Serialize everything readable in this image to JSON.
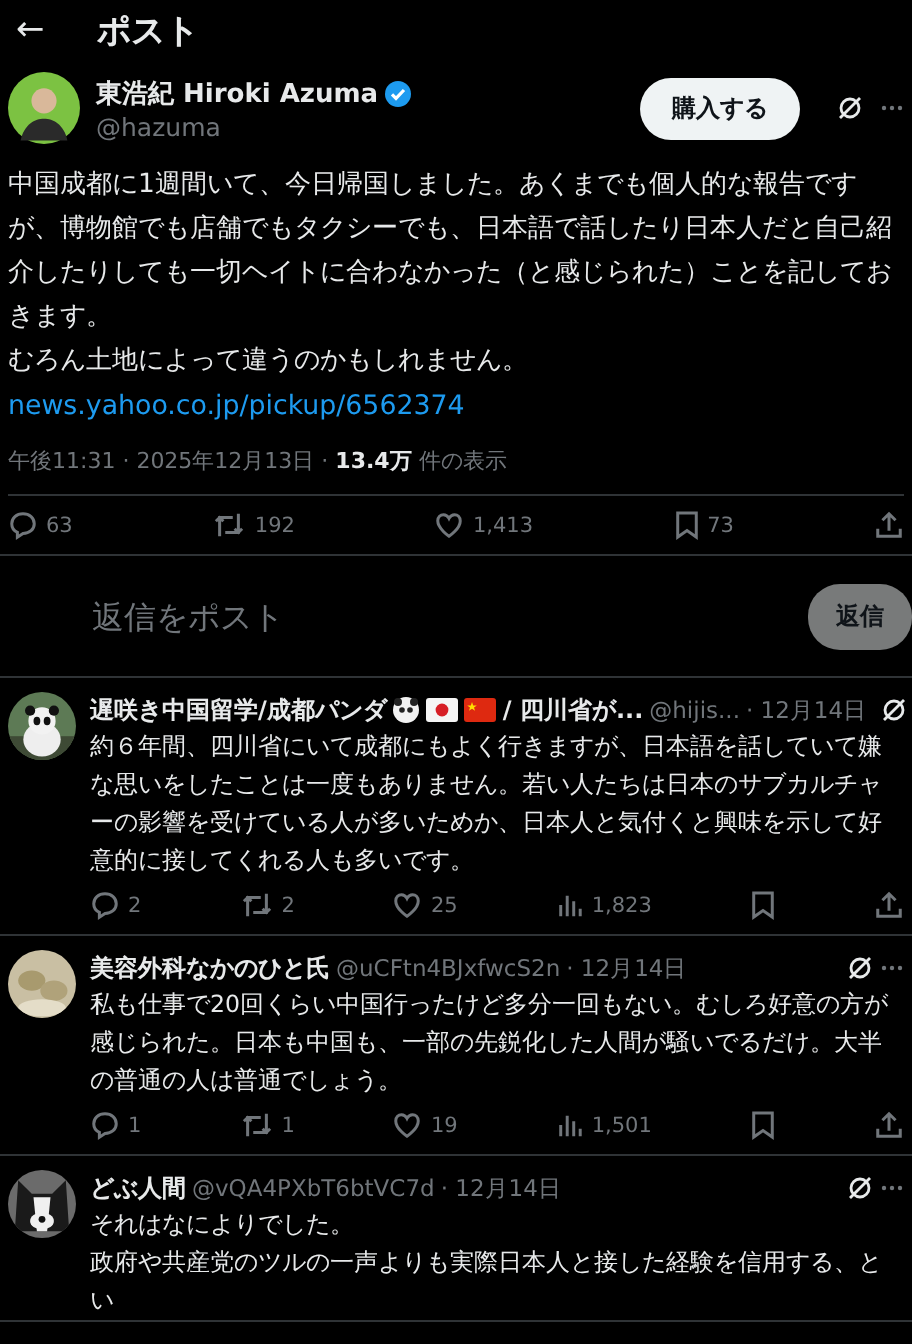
{
  "header": {
    "back": "←",
    "title": "ポスト"
  },
  "post": {
    "author": "東浩紀 Hiroki Azuma",
    "verified": true,
    "handle": "@hazuma",
    "buy_button": "購入する",
    "paragraphs": [
      "中国成都に1週間いて、今日帰国しました。あくまでも個人的な報告ですが、博物館でも店舗でもタクシーでも、日本語で話したり日本人だと自己紹介したりしても一切ヘイトに合わなかった（と感じられた）ことを記しておきます。",
      "むろん土地によって違うのかもしれません。"
    ],
    "link": "news.yahoo.co.jp/pickup/6562374",
    "meta": "午後11:31 · 2025年12月13日 · ",
    "views": "13.4万",
    "views_suffix": " 件の表示",
    "actions": [
      {
        "kind": "reply",
        "count": "63"
      },
      {
        "kind": "repost",
        "count": "192"
      },
      {
        "kind": "like",
        "count": "1,413"
      },
      {
        "kind": "bookmark",
        "count": "73"
      },
      {
        "kind": "share"
      }
    ]
  },
  "reply_box": {
    "placeholder": "返信をポスト",
    "button": "返信"
  },
  "replies": [
    {
      "name": [
        {
          "kind": "text",
          "text": "遅咲き中国留学/成都パンダ"
        },
        {
          "kind": "panda"
        },
        {
          "kind": "flag-jp"
        },
        {
          "kind": "flag-cn"
        },
        {
          "kind": "text",
          "text": "/ 四川省が..."
        }
      ],
      "handle": "@hijis...",
      "date": "· 12月14日",
      "paragraphs": [
        "約６年間、四川省にいて成都にもよく行きますが、日本語を話していて嫌な思いをしたことは一度もありません。若い人たちは日本のサブカルチャーの影響を受けている人が多いためか、日本人と気付くと興味を示して好意的に接してくれる人も多いです。"
      ],
      "actions": [
        {
          "kind": "reply",
          "count": "2"
        },
        {
          "kind": "repost",
          "count": "2"
        },
        {
          "kind": "like",
          "count": "25"
        },
        {
          "kind": "views",
          "count": "1,823"
        },
        {
          "kind": "bookmark"
        },
        {
          "kind": "share"
        }
      ]
    },
    {
      "name": [
        {
          "kind": "text",
          "text": "美容外科なかのひと氏"
        }
      ],
      "handle": "@uCFtn4BJxfwcS2n",
      "date": "· 12月14日",
      "paragraphs": [
        "私も仕事で20回くらい中国行ったけど多分一回もない。むしろ好意の方が感じられた。日本も中国も、一部の先鋭化した人間が騒いでるだけ。大半の普通の人は普通でしょう。"
      ],
      "actions": [
        {
          "kind": "reply",
          "count": "1"
        },
        {
          "kind": "repost",
          "count": "1"
        },
        {
          "kind": "like",
          "count": "19"
        },
        {
          "kind": "views",
          "count": "1,501"
        },
        {
          "kind": "bookmark"
        },
        {
          "kind": "share"
        }
      ]
    },
    {
      "name": [
        {
          "kind": "text",
          "text": "どぶ人間"
        }
      ],
      "handle": "@vQA4PXbT6btVC7d",
      "date": "· 12月14日",
      "paragraphs": [
        "それはなによりでした。",
        "政府や共産党のツルの一声よりも実際日本人と接した経験を信用する、とい"
      ]
    }
  ]
}
